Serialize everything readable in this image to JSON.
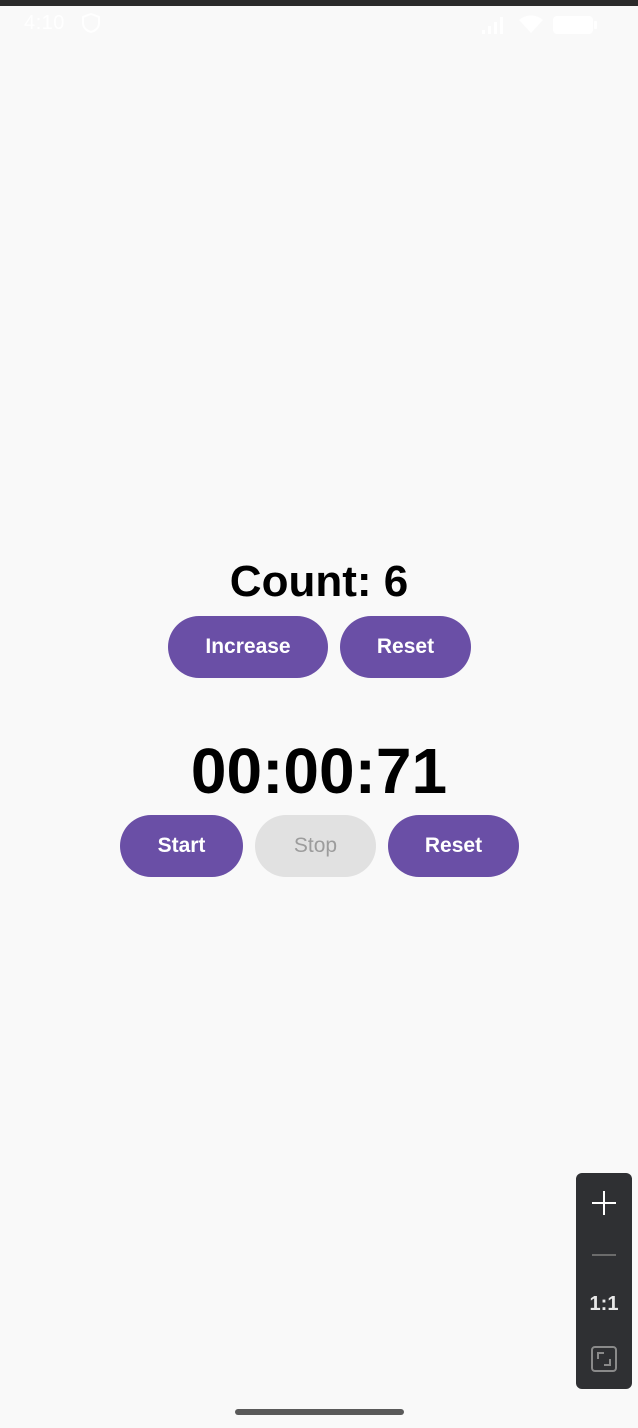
{
  "status_bar": {
    "time": "4:10",
    "icons": [
      "shield-icon",
      "signal-icon",
      "wifi-icon",
      "battery-icon"
    ]
  },
  "counter": {
    "title": "Count: 6",
    "increase_label": "Increase",
    "reset_label": "Reset"
  },
  "stopwatch": {
    "time": "00:00:71",
    "start_label": "Start",
    "stop_label": "Stop",
    "reset_label": "Reset"
  },
  "zoom_controls": {
    "ratio_label": "1:1",
    "icons": [
      "plus-icon",
      "minus-icon",
      "fit-screen-icon"
    ]
  },
  "colors": {
    "primary": "#6a4fa6",
    "disabled_bg": "#e1e1e1",
    "disabled_text": "#9c9c9c",
    "background": "#f9f9f9"
  }
}
